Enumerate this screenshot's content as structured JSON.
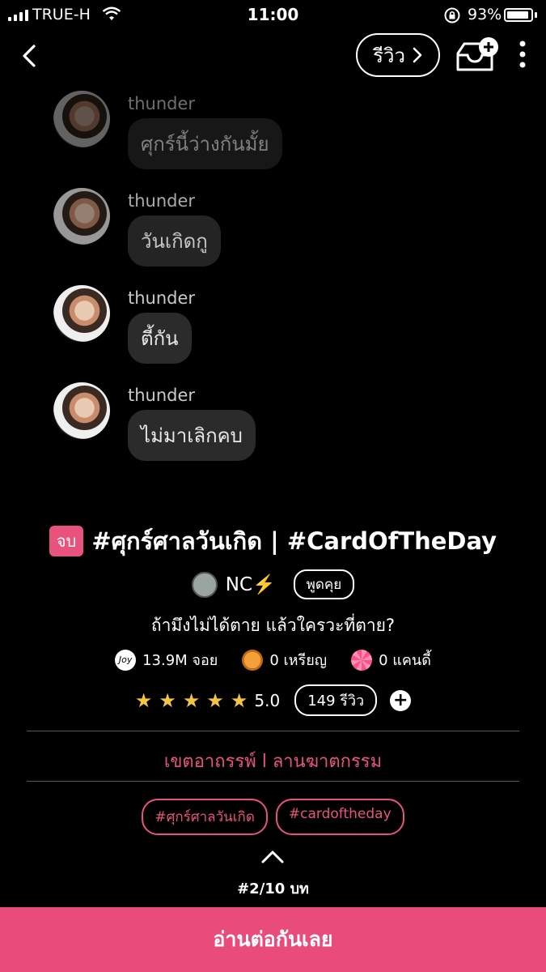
{
  "status_bar": {
    "carrier": "TRUE-H",
    "time": "11:00",
    "battery": "93%",
    "battery_level": 0.93
  },
  "nav": {
    "review_label": "รีวิว",
    "back_icon": "chevron-left-icon",
    "inbox_icon": "inbox-add-icon",
    "more_icon": "more-vertical-icon"
  },
  "chat": {
    "messages": [
      {
        "sender": "thunder",
        "text": "ศุกร์นี้ว่างกันมั้ย"
      },
      {
        "sender": "thunder",
        "text": "วันเกิดกู"
      },
      {
        "sender": "thunder",
        "text": "ตี้กัน"
      },
      {
        "sender": "thunder",
        "text": "ไม่มาเลิกคบ"
      }
    ]
  },
  "story": {
    "status_badge": "จบ",
    "title": "#ศุกร์ศาลวันเกิด | #CardOfTheDay",
    "author": "NC⚡️",
    "chat_label": "พูดคุย",
    "tagline": "ถ้ามึงไม่ได้ตาย แล้วใครวะที่ตาย?",
    "stats": {
      "joy": "13.9M จอย",
      "coins": "0 เหรียญ",
      "candy": "0 แคนดี้"
    },
    "rating": {
      "stars": 5,
      "score": "5.0",
      "review_count": "149 รีวิว"
    },
    "category": "เขตอาถรรพ์ l ลานฆาตกรรม",
    "tags": [
      "#ศุกร์ศาลวันเกิด",
      "#cardoftheday"
    ],
    "chapter": "#2/10 บท"
  },
  "cta": {
    "label": "อ่านต่อกันเลย"
  },
  "colors": {
    "accent": "#e94b7a",
    "star": "#f4c542",
    "bubble": "#2b2b2b"
  }
}
